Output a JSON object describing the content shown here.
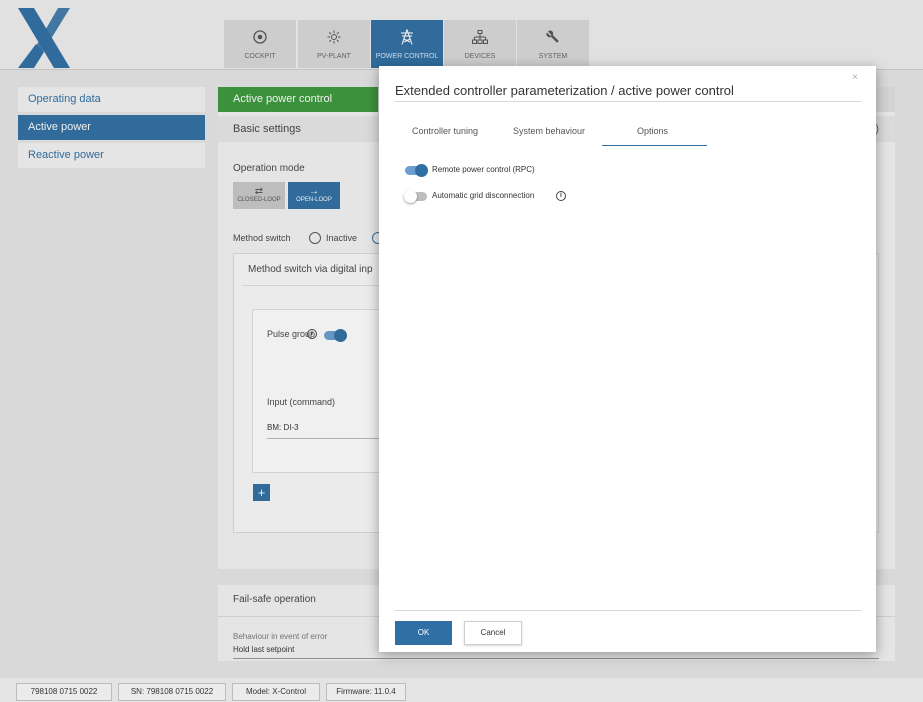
{
  "nav": {
    "tabs": [
      {
        "label": "COCKPIT",
        "icon": "target-icon"
      },
      {
        "label": "PV-PLANT",
        "icon": "sun-icon"
      },
      {
        "label": "POWER CONTROL",
        "icon": "power-tower-icon",
        "active": true
      },
      {
        "label": "DEVICES",
        "icon": "network-icon"
      },
      {
        "label": "SYSTEM",
        "icon": "wrench-icon"
      }
    ]
  },
  "sidebar": {
    "items": [
      {
        "label": "Operating data"
      },
      {
        "label": "Active power",
        "active": true
      },
      {
        "label": "Reactive power"
      }
    ]
  },
  "content": {
    "title": "Active power control",
    "basic_settings": "Basic settings",
    "operation_mode": "Operation mode",
    "closed_loop": "CLOSED-LOOP",
    "open_loop": "OPEN-LOOP",
    "method_switch": "Method switch",
    "inactive": "Inactive",
    "method_box_title": "Method switch via digital inp",
    "pulse_group": "Pulse group",
    "input_command": "Input (command)",
    "input_value": "BM: DI-3",
    "add_label": "+"
  },
  "failsafe": {
    "title": "Fail-safe operation",
    "behaviour_label": "Behaviour in event of error",
    "behaviour_value": "Hold last setpoint"
  },
  "statusbar": {
    "id": "798108 0715 0022",
    "sn": "SN: 798108 0715 0022",
    "model": "Model: X-Control",
    "firmware": "Firmware: 11.0.4"
  },
  "modal": {
    "title": "Extended controller parameterization / active power control",
    "close": "×",
    "tabs": [
      {
        "label": "Controller tuning"
      },
      {
        "label": "System behaviour"
      },
      {
        "label": "Options",
        "active": true
      }
    ],
    "options": {
      "rpc_label": "Remote power control (RPC)",
      "rpc_enabled": true,
      "grid_disc_label": "Automatic grid disconnection",
      "grid_disc_enabled": false
    },
    "ok": "OK",
    "cancel": "Cancel"
  },
  "colors": {
    "accent": "#2f6fa3",
    "title_green": "#3c9a3c"
  }
}
